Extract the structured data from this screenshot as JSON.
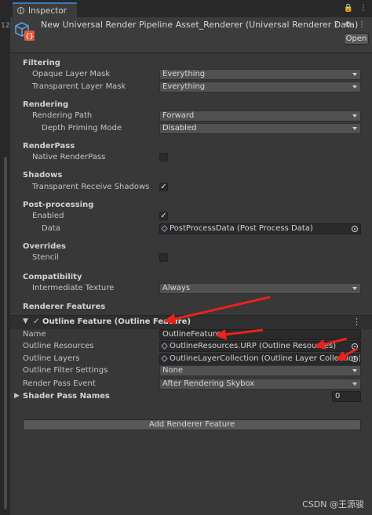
{
  "sidebar": {
    "number": "12"
  },
  "tab": {
    "label": "Inspector"
  },
  "tab_tools": {
    "lock": "🔒",
    "menu": "⋮"
  },
  "header": {
    "title": "New Universal Render Pipeline Asset_Renderer (Universal Renderer Data)",
    "help": "?",
    "settings": "⚙",
    "menu": "⋮",
    "open_label": "Open"
  },
  "filtering": {
    "title": "Filtering",
    "opaque_label": "Opaque Layer Mask",
    "opaque_value": "Everything",
    "transparent_label": "Transparent Layer Mask",
    "transparent_value": "Everything"
  },
  "rendering": {
    "title": "Rendering",
    "path_label": "Rendering Path",
    "path_value": "Forward",
    "depth_label": "Depth Priming Mode",
    "depth_value": "Disabled"
  },
  "renderpass": {
    "title": "RenderPass",
    "native_label": "Native RenderPass",
    "native_checked": false
  },
  "shadows": {
    "title": "Shadows",
    "trs_label": "Transparent Receive Shadows",
    "trs_checked": true
  },
  "postprocessing": {
    "title": "Post-processing",
    "enabled_label": "Enabled",
    "enabled_checked": true,
    "data_label": "Data",
    "data_value": "PostProcessData (Post Process Data)"
  },
  "overrides": {
    "title": "Overrides",
    "stencil_label": "Stencil",
    "stencil_checked": false
  },
  "compatibility": {
    "title": "Compatibility",
    "tex_label": "Intermediate Texture",
    "tex_value": "Always"
  },
  "renderer_features": {
    "title": "Renderer Features",
    "feature_title": "Outline Feature (Outline Feature)",
    "name_label": "Name",
    "name_value": "OutlineFeature",
    "resources_label": "Outline Resources",
    "resources_value": "OutlineResources.URP (Outline Resources)",
    "layers_label": "Outline Layers",
    "layers_value": "OutlineLayerCollection (Outline Layer Collection)",
    "filter_label": "Outline Filter Settings",
    "filter_value": "None",
    "event_label": "Render Pass Event",
    "event_value": "After Rendering Skybox",
    "shader_label": "Shader Pass Names",
    "shader_value": "0",
    "add_label": "Add Renderer Feature"
  },
  "watermark": "CSDN @王源骏",
  "colors": {
    "accent": "#3a79bb",
    "annotation_arrow": "#e8231c",
    "background": "#383838"
  }
}
